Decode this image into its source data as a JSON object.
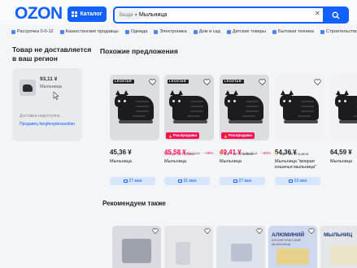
{
  "header": {
    "logo": "OZON",
    "catalog_label": "Каталог",
    "search": {
      "category": "Везде",
      "value": "Мыльница"
    },
    "colors": {
      "brand": "#1160ff",
      "sale": "#f91155"
    }
  },
  "quicknav": [
    {
      "icon": "installment-icon",
      "label": "Рассрочка 0-0-12"
    },
    {
      "icon": "kz-flag-icon",
      "label": "Казахстанские продавцы"
    },
    {
      "icon": "clothes-icon",
      "label": "Одежда"
    },
    {
      "icon": "electronics-icon",
      "label": "Электроника"
    },
    {
      "icon": "home-icon",
      "label": "Дом и сад"
    },
    {
      "icon": "kids-icon",
      "label": "Детские товары"
    },
    {
      "icon": "appliances-icon",
      "label": "Бытовая техника"
    },
    {
      "icon": "construction-icon",
      "label": "Строительство"
    }
  ],
  "left": {
    "title": "Товар не доставляется в ваш регион",
    "product": {
      "price": "93,11 ¥",
      "name": "Мыльница",
      "delivery": "Доставка недоступна",
      "seller": "Продавец fangfengdexiaodian"
    }
  },
  "similar": {
    "title": "Похожие предложения",
    "items": [
      {
        "brand": "LEOSTAR",
        "price": "45,36 ¥",
        "sale": false,
        "old": "",
        "disc": "",
        "note": "",
        "rating": "",
        "reviews": "",
        "title": "Мыльница",
        "delivery": "27 мая",
        "sale_badge": ""
      },
      {
        "brand": "LEOSTAR",
        "price": "45,58 ¥",
        "sale": true,
        "old": "85,03 ¥",
        "disc": "−46%",
        "note": "100 шт осталось",
        "rating": "",
        "reviews": "",
        "title": "Мыльница",
        "delivery": "31 мая",
        "sale_badge": "Распродажа"
      },
      {
        "brand": "LEOSTAR",
        "price": "49,41 ¥",
        "sale": true,
        "old": "146,20 ¥",
        "disc": "−66%",
        "note": "",
        "rating": "5.0",
        "reviews": "10 отзывов",
        "title": "Мыльница",
        "delivery": "27 мая",
        "sale_badge": "Распродажа"
      },
      {
        "brand": "",
        "price": "54,36 ¥",
        "sale": false,
        "old": "",
        "disc": "",
        "note": "",
        "rating": "4.8",
        "reviews": "15 отзывов",
        "title": "Мыльница \"мокрая кошачья мыльница\"",
        "delivery": "23 мая",
        "sale_badge": ""
      },
      {
        "brand": "",
        "price": "64,59 ¥",
        "sale": false,
        "old": "",
        "disc": "",
        "note": "",
        "rating": "",
        "reviews": "",
        "title": "Мыльница",
        "delivery": "",
        "sale_badge": ""
      }
    ]
  },
  "recommend": {
    "title": "Рекомендуем также",
    "labels": [
      "",
      "",
      "",
      "АЛЮМИНИЙ",
      "МЫЛЬНИЦ"
    ],
    "sublabels": [
      "",
      "",
      "",
      "КОСМЕТИЧЕСКИЙ МЫЛЬНИЦА",
      ""
    ]
  }
}
